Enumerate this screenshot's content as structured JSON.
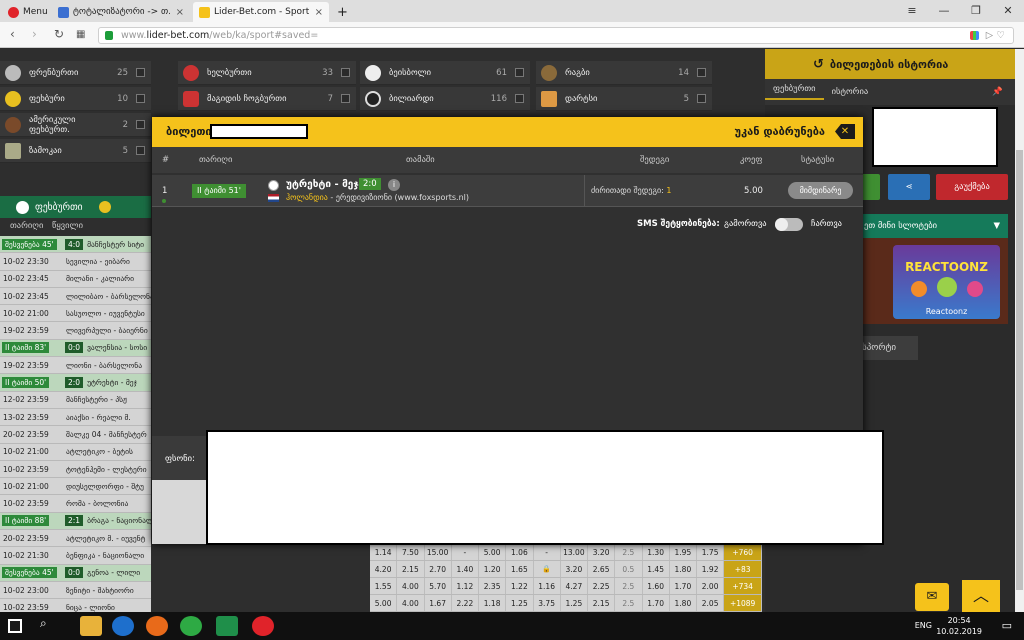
{
  "browser": {
    "menu_label": "Menu",
    "tabs": [
      {
        "label": "ტოტალიზატორი -> თ..."
      },
      {
        "label": "Lider-Bet.com - Sports and"
      }
    ],
    "url_gray": "www.",
    "url_host": "lider-bet.com",
    "url_path": "/web/ka/sport#saved="
  },
  "sports_grid": [
    {
      "name": "ფრენბურთი",
      "count": "25"
    },
    {
      "name": "ხელბურთი",
      "count": "33"
    },
    {
      "name": "ბეისბოლი",
      "count": "61"
    },
    {
      "name": "რაგბი",
      "count": "14"
    },
    {
      "name": "ფეხბური",
      "count": "10"
    },
    {
      "name": "მაგიდის ჩოგბურთი",
      "count": "7"
    },
    {
      "name": "ბილიარდი",
      "count": "116"
    },
    {
      "name": "დარტსი",
      "count": "5"
    },
    {
      "name": "ამერიკული ფეხბურთ.",
      "count": "2"
    },
    {
      "name": "ზამოკაი",
      "count": "5"
    }
  ],
  "right_panel": {
    "bet_history": "ბილეთების ისტორია",
    "tab_sports": "ფეხბურთი",
    "tab_history": "ისტორია",
    "share_icon_label": "share",
    "cancel_label": "გაუქმება",
    "slots_header": "ეთ მინი სლოტები",
    "slot_title": "REACTOONZ",
    "slot_caption": "Reactoonz",
    "sports_tab": "სპორტი"
  },
  "left_panel": {
    "football_tab": "ფეხბურთი",
    "col_date": "თარიღი",
    "col_pair": "წყვილი",
    "events": [
      {
        "time": "",
        "live": "შესვენება 45'",
        "score": "4:0",
        "teams": "მანჩესტერ სიტი"
      },
      {
        "time": "10-02 23:30",
        "live": "",
        "score": "",
        "teams": "სევილია - ეიბარი"
      },
      {
        "time": "10-02 23:45",
        "live": "",
        "score": "",
        "teams": "მილანი - კალიარი"
      },
      {
        "time": "10-02 23:45",
        "live": "",
        "score": "",
        "teams": "ლილიბაო - ბარსელონა"
      },
      {
        "time": "10-02 21:00",
        "live": "",
        "score": "",
        "teams": "სასუოლო - იუვენტუსი"
      },
      {
        "time": "19-02 23:59",
        "live": "",
        "score": "",
        "teams": "ლივერპული - ბაიერნი"
      },
      {
        "time": "",
        "live": "II ტაიმი 83'",
        "score": "0:0",
        "teams": "ვალენსია - სოსი"
      },
      {
        "time": "19-02 23:59",
        "live": "",
        "score": "",
        "teams": "ლიონი - ბარსელონა"
      },
      {
        "time": "",
        "live": "II ტაიმი 50'",
        "score": "2:0",
        "teams": "უტრეხტი - მეჯ"
      },
      {
        "time": "12-02 23:59",
        "live": "",
        "score": "",
        "teams": "მანჩესტერი - პსჟ"
      },
      {
        "time": "13-02 23:59",
        "live": "",
        "score": "",
        "teams": "აიაქსი - რეალი მ."
      },
      {
        "time": "20-02 23:59",
        "live": "",
        "score": "",
        "teams": "შალკე 04 - მანჩესტერ"
      },
      {
        "time": "10-02 21:00",
        "live": "",
        "score": "",
        "teams": "ატლეტიკო - ბეტის"
      },
      {
        "time": "10-02 23:59",
        "live": "",
        "score": "",
        "teams": "ტოტენჰემი - ლესტერი"
      },
      {
        "time": "10-02 21:00",
        "live": "",
        "score": "",
        "teams": "დიუსელდორფი - შტუ"
      },
      {
        "time": "10-02 23:59",
        "live": "",
        "score": "",
        "teams": "რომა - ბოლონია"
      },
      {
        "time": "",
        "live": "II ტაიმი 88'",
        "score": "2:1",
        "teams": "ბრაგა - ნაციონალი"
      },
      {
        "time": "20-02 23:59",
        "live": "",
        "score": "",
        "teams": "ატლეტიკო მ. - იუვენტ"
      },
      {
        "time": "10-02 21:30",
        "live": "",
        "score": "",
        "teams": "ბენფიკა - ნაციონალი"
      },
      {
        "time": "",
        "live": "შესვენება 45'",
        "score": "0:0",
        "teams": "გენოა - ლილი"
      },
      {
        "time": "10-02 23:00",
        "live": "",
        "score": "",
        "teams": "ზენიტი - შახტიორი"
      },
      {
        "time": "10-02 23:59",
        "live": "",
        "score": "",
        "teams": "ნიცა - ლიონი"
      }
    ]
  },
  "odds_rows": [
    [
      "1.14",
      "7.50",
      "15.00",
      "-",
      "5.00",
      "1.06",
      "-",
      "13.00",
      "3.20",
      "2.5",
      "1.30",
      "1.95",
      "1.75",
      "+760"
    ],
    [
      "4.20",
      "2.15",
      "2.70",
      "1.40",
      "1.20",
      "1.65",
      "lock",
      "3.20",
      "2.65",
      "0.5",
      "1.45",
      "1.80",
      "1.92",
      "+83"
    ],
    [
      "1.55",
      "4.00",
      "5.70",
      "1.12",
      "2.35",
      "1.22",
      "1.16",
      "4.27",
      "2.25",
      "2.5",
      "1.60",
      "1.70",
      "2.00",
      "+734"
    ],
    [
      "5.00",
      "4.00",
      "1.67",
      "2.22",
      "1.18",
      "1.25",
      "3.75",
      "1.25",
      "2.15",
      "2.5",
      "1.70",
      "1.80",
      "2.05",
      "+1089"
    ]
  ],
  "modal": {
    "title": "ბილეთი",
    "back_label": "უკან დაბრუნება",
    "close_icon": "back-arrow-close",
    "cols": {
      "num": "#",
      "date": "თარიღი",
      "event": "თამაში",
      "outcome": "შედეგი",
      "coef": "კოეფ",
      "status": "სტატუსი"
    },
    "row": {
      "num": "1",
      "live_badge": "II ტაიმი 51'",
      "match": "უტრეხტი - მეჯ",
      "score": "2:0",
      "info": "i",
      "league_country": "ჰოლანდია",
      "league_name": "- ერედივიზიონი (www.foxsports.nl)",
      "outcome_label": "ძირითადი შედეგი:",
      "outcome_value": "1",
      "coef": "5.00",
      "status": "მიმდინარე"
    },
    "sms_label": "SMS შეტყობინება:",
    "sms_off": "გამორთვა",
    "sms_on": "ჩართვა",
    "price_label": "ფსონი:"
  },
  "taskbar": {
    "lang": "ENG",
    "time": "20:54",
    "date": "10.02.2019"
  },
  "colors": {
    "accent": "#f5c21b",
    "green": "#3f8f32",
    "page_bg": "#2e2e2e"
  }
}
